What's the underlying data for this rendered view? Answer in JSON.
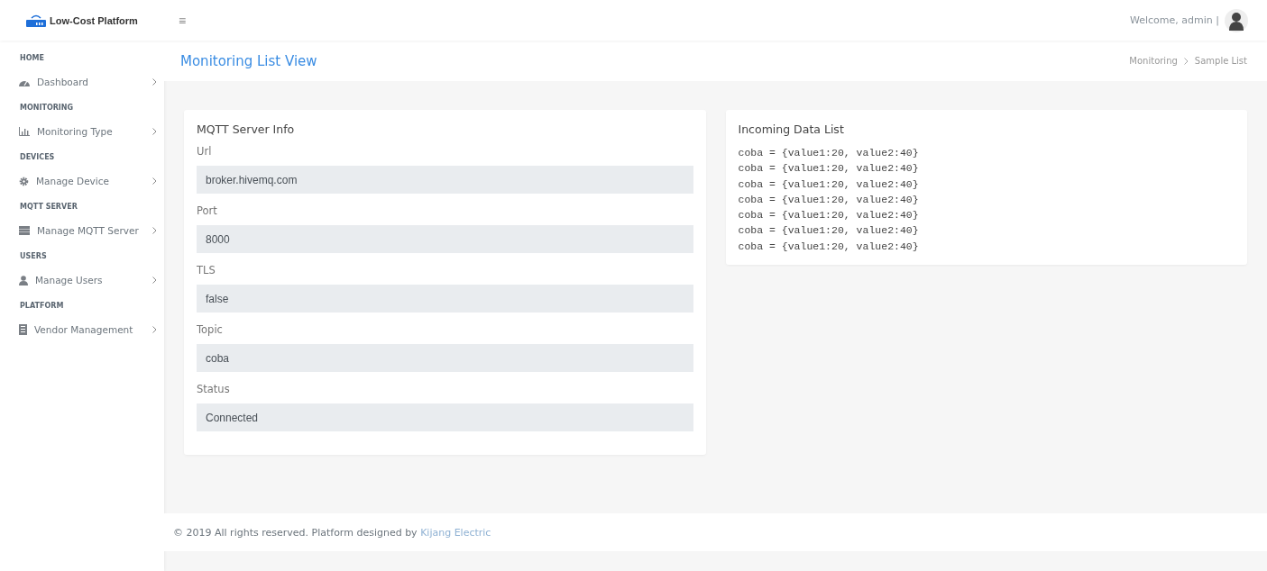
{
  "brand": {
    "title": "Low-Cost Platform"
  },
  "topbar": {
    "menu_icon": "≡",
    "welcome": "Welcome, admin |"
  },
  "sidebar": {
    "sections": [
      {
        "header": "HOME",
        "items": [
          {
            "label": "Dashboard",
            "kind": "dashboard"
          }
        ]
      },
      {
        "header": "MONITORING",
        "items": [
          {
            "label": "Monitoring Type",
            "kind": "chart"
          }
        ]
      },
      {
        "header": "DEVICES",
        "items": [
          {
            "label": "Manage Device",
            "kind": "gear"
          }
        ]
      },
      {
        "header": "MQTT SERVER",
        "items": [
          {
            "label": "Manage MQTT Server",
            "kind": "server"
          }
        ]
      },
      {
        "header": "USERS",
        "items": [
          {
            "label": "Manage Users",
            "kind": "user"
          }
        ]
      },
      {
        "header": "PLATFORM",
        "items": [
          {
            "label": "Vendor Management",
            "kind": "building"
          }
        ]
      }
    ]
  },
  "page_header": {
    "title": "Monitoring List View",
    "breadcrumb": [
      "Monitoring",
      "Sample List"
    ]
  },
  "server_info": {
    "title": "MQTT Server Info",
    "fields": [
      {
        "label": "Url",
        "value": "broker.hivemq.com"
      },
      {
        "label": "Port",
        "value": "8000"
      },
      {
        "label": "TLS",
        "value": "false"
      },
      {
        "label": "Topic",
        "value": "coba"
      },
      {
        "label": "Status",
        "value": "Connected"
      }
    ]
  },
  "incoming": {
    "title": "Incoming Data List",
    "lines": [
      "coba = {value1:20, value2:40}",
      "coba = {value1:20, value2:40}",
      "coba = {value1:20, value2:40}",
      "coba = {value1:20, value2:40}",
      "coba = {value1:20, value2:40}",
      "coba = {value1:20, value2:40}",
      "coba = {value1:20, value2:40}"
    ]
  },
  "footer": {
    "text": "© 2019 All rights reserved. Platform designed by",
    "link": "Kijang Electric"
  }
}
